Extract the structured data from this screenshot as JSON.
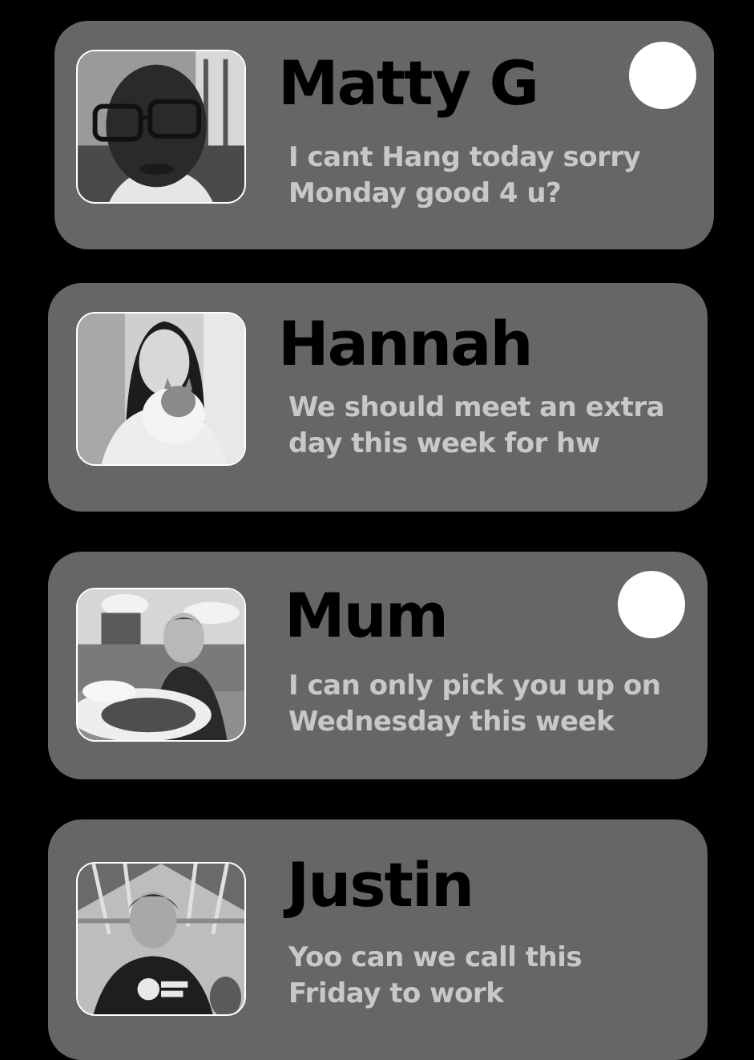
{
  "colors": {
    "background": "#000000",
    "card": "#666666",
    "name_text": "#000000",
    "message_text": "#c8c8c8",
    "unread_dot": "#ffffff"
  },
  "conversations": [
    {
      "name": "Matty G",
      "message_line1": "I cant Hang today sorry",
      "message_line2": "Monday good 4 u?",
      "unread": true,
      "avatar_icon": "profile-photo-icon"
    },
    {
      "name": "Hannah",
      "message_line1": "We should meet an extra",
      "message_line2": "day this week for hw",
      "unread": false,
      "avatar_icon": "profile-photo-icon"
    },
    {
      "name": "Mum",
      "message_line1": "I can only pick you up on",
      "message_line2": "Wednesday this week",
      "unread": true,
      "avatar_icon": "profile-photo-icon"
    },
    {
      "name": "Justin",
      "message_line1": "Yoo can we call this",
      "message_line2": "Friday to work",
      "unread": false,
      "avatar_icon": "profile-photo-icon"
    }
  ]
}
